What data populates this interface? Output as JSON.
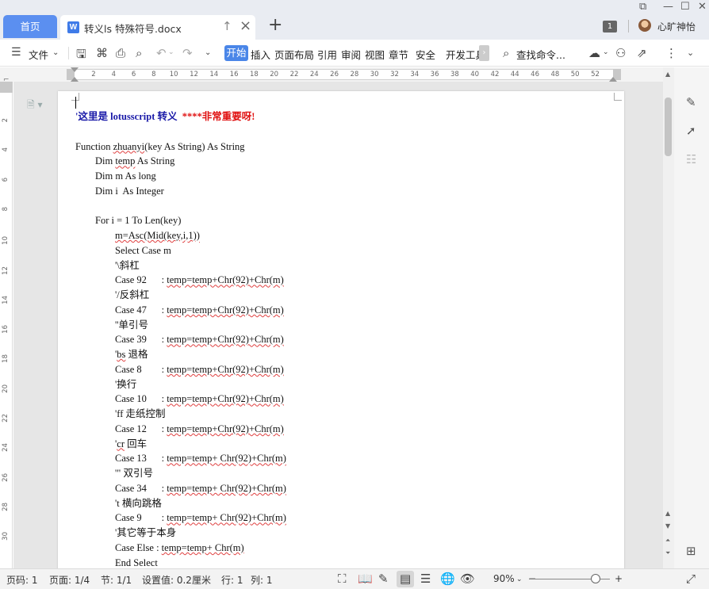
{
  "tabs": {
    "home": "首页",
    "document": "转义ls 特殊符号.docx",
    "doc_icon": "W",
    "new_tab": "+"
  },
  "window": {
    "badge": "1",
    "user": "心旷神怡"
  },
  "ribbon": {
    "file": "文件",
    "items": [
      "开始",
      "插入",
      "页面布局",
      "引用",
      "审阅",
      "视图",
      "章节",
      "安全",
      "开发工具"
    ],
    "search": "查找命令..."
  },
  "ruler": {
    "h": [
      "2",
      "4",
      "6",
      "8",
      "10",
      "12",
      "14",
      "16",
      "18",
      "20",
      "22",
      "24",
      "26",
      "28",
      "30",
      "32",
      "34",
      "36",
      "38",
      "40",
      "42",
      "44",
      "46",
      "48",
      "50",
      "52"
    ],
    "v": [
      "2",
      "4",
      "6",
      "8",
      "10",
      "12",
      "14",
      "16",
      "18",
      "20",
      "22",
      "24",
      "26",
      "28",
      "30"
    ]
  },
  "document": {
    "lines": [
      {
        "indent": 0,
        "parts": [
          {
            "t": "'这里是 ",
            "c": "head-blue"
          },
          {
            "t": "lotusscript",
            "c": "head-blue"
          },
          {
            "t": " 转义  ",
            "c": "head-blue"
          },
          {
            "t": "****非常重要呀!",
            "c": "head-red"
          }
        ]
      },
      {
        "indent": 0,
        "parts": [
          {
            "t": ""
          }
        ]
      },
      {
        "indent": 0,
        "parts": [
          {
            "t": "Function "
          },
          {
            "t": "zhuanyi",
            "c": "sq"
          },
          {
            "t": "(key As String) As String"
          }
        ]
      },
      {
        "indent": 1,
        "parts": [
          {
            "t": "Dim "
          },
          {
            "t": "temp",
            "c": "sq"
          },
          {
            "t": " As String"
          }
        ]
      },
      {
        "indent": 1,
        "parts": [
          {
            "t": "Dim m As long"
          }
        ]
      },
      {
        "indent": 1,
        "parts": [
          {
            "t": "Dim i  As Integer"
          }
        ]
      },
      {
        "indent": 0,
        "parts": [
          {
            "t": ""
          }
        ]
      },
      {
        "indent": 1,
        "parts": [
          {
            "t": "For i = 1 To Len(key)"
          }
        ]
      },
      {
        "indent": 2,
        "parts": [
          {
            "t": "m=Asc(Mid(key,i,1))",
            "c": "sq"
          }
        ]
      },
      {
        "indent": 2,
        "parts": [
          {
            "t": "Select Case m"
          }
        ]
      },
      {
        "indent": 2,
        "parts": [
          {
            "t": "'\\斜杠"
          }
        ]
      },
      {
        "indent": 2,
        "parts": [
          {
            "t": "Case 92      : "
          },
          {
            "t": "temp=temp+Chr(92)+Chr(m)",
            "c": "sq"
          }
        ]
      },
      {
        "indent": 2,
        "parts": [
          {
            "t": "'/反斜杠"
          }
        ]
      },
      {
        "indent": 2,
        "parts": [
          {
            "t": "Case 47      : "
          },
          {
            "t": "temp=temp+Chr(92)+Chr(m)",
            "c": "sq"
          }
        ]
      },
      {
        "indent": 2,
        "parts": [
          {
            "t": "''单引号"
          }
        ]
      },
      {
        "indent": 2,
        "parts": [
          {
            "t": "Case 39      : "
          },
          {
            "t": "temp=temp+Chr(92)+Chr(m)",
            "c": "sq"
          }
        ]
      },
      {
        "indent": 2,
        "parts": [
          {
            "t": "'"
          },
          {
            "t": "bs",
            "c": "sq"
          },
          {
            "t": " 退格"
          }
        ]
      },
      {
        "indent": 2,
        "parts": [
          {
            "t": "Case 8        : "
          },
          {
            "t": "temp=temp+Chr(92)+Chr(m)",
            "c": "sq"
          }
        ]
      },
      {
        "indent": 2,
        "parts": [
          {
            "t": "'换行"
          }
        ]
      },
      {
        "indent": 2,
        "parts": [
          {
            "t": "Case 10      : "
          },
          {
            "t": "temp=temp+Chr(92)+Chr(m)",
            "c": "sq"
          }
        ]
      },
      {
        "indent": 2,
        "parts": [
          {
            "t": "'ff 走纸控制"
          }
        ]
      },
      {
        "indent": 2,
        "parts": [
          {
            "t": "Case 12      : "
          },
          {
            "t": "temp=temp+Chr(92)+Chr(m)",
            "c": "sq"
          }
        ]
      },
      {
        "indent": 2,
        "parts": [
          {
            "t": "'"
          },
          {
            "t": "cr",
            "c": "sq"
          },
          {
            "t": " 回车"
          }
        ]
      },
      {
        "indent": 2,
        "parts": [
          {
            "t": "Case 13      : "
          },
          {
            "t": "temp=temp+ Chr(92)+Chr(m)",
            "c": "sq"
          }
        ]
      },
      {
        "indent": 2,
        "parts": [
          {
            "t": "'\" 双引号"
          }
        ]
      },
      {
        "indent": 2,
        "parts": [
          {
            "t": "Case 34      : "
          },
          {
            "t": "temp=temp+ Chr(92)+Chr(m)",
            "c": "sq"
          }
        ]
      },
      {
        "indent": 2,
        "parts": [
          {
            "t": "'t 横向跳格"
          }
        ]
      },
      {
        "indent": 2,
        "parts": [
          {
            "t": "Case 9        : "
          },
          {
            "t": "temp=temp+ Chr(92)+Chr(m)",
            "c": "sq"
          }
        ]
      },
      {
        "indent": 2,
        "parts": [
          {
            "t": "'其它等于本身"
          }
        ]
      },
      {
        "indent": 2,
        "parts": [
          {
            "t": "Case Else : "
          },
          {
            "t": "temp=temp+ Chr(m)",
            "c": "sq"
          }
        ]
      },
      {
        "indent": 2,
        "parts": [
          {
            "t": "End Select"
          }
        ]
      }
    ]
  },
  "status": {
    "page_num": "页码: 1",
    "pages": "页面: 1/4",
    "section": "节: 1/1",
    "setting": "设置值: 0.2厘米",
    "row": "行: 1",
    "col": "列: 1",
    "zoom": "90%"
  },
  "colors": {
    "accent": "#4a86e8",
    "home_tab": "#5b8ff0",
    "heading_blue": "#1a1aa8",
    "heading_red": "#e01010"
  }
}
